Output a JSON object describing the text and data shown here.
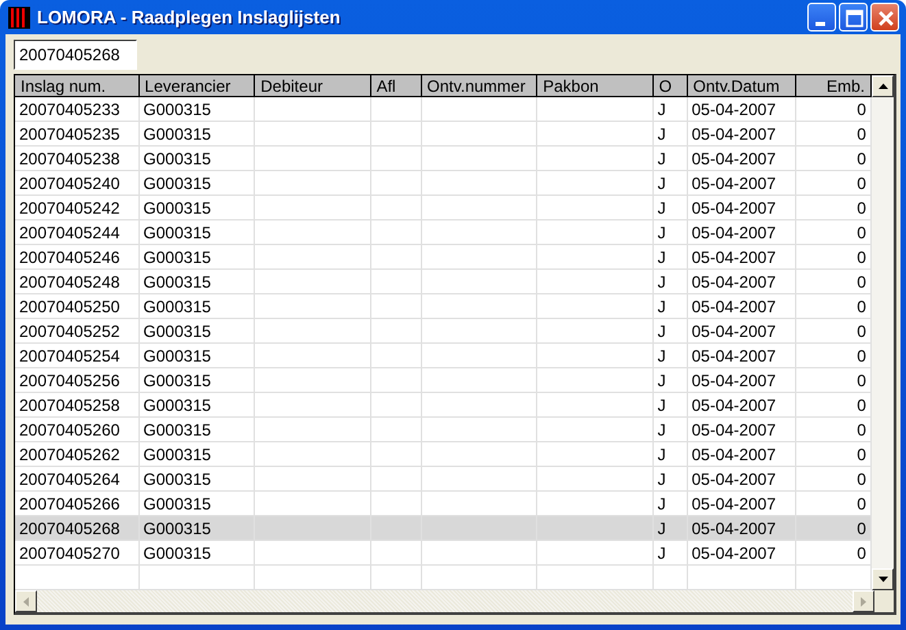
{
  "window": {
    "title": "LOMORA - Raadplegen Inslaglijsten"
  },
  "search": {
    "value": "20070405268"
  },
  "table": {
    "columns": [
      "Inslag num.",
      "Leverancier",
      "Debiteur",
      "Afl",
      "Ontv.nummer",
      "Pakbon",
      "O",
      "Ontv.Datum",
      "Emb."
    ],
    "rows": [
      {
        "cells": [
          "20070405233",
          "G000315",
          "",
          "",
          "",
          "",
          "J",
          "05-04-2007",
          "0"
        ],
        "selected": false
      },
      {
        "cells": [
          "20070405235",
          "G000315",
          "",
          "",
          "",
          "",
          "J",
          "05-04-2007",
          "0"
        ],
        "selected": false
      },
      {
        "cells": [
          "20070405238",
          "G000315",
          "",
          "",
          "",
          "",
          "J",
          "05-04-2007",
          "0"
        ],
        "selected": false
      },
      {
        "cells": [
          "20070405240",
          "G000315",
          "",
          "",
          "",
          "",
          "J",
          "05-04-2007",
          "0"
        ],
        "selected": false
      },
      {
        "cells": [
          "20070405242",
          "G000315",
          "",
          "",
          "",
          "",
          "J",
          "05-04-2007",
          "0"
        ],
        "selected": false
      },
      {
        "cells": [
          "20070405244",
          "G000315",
          "",
          "",
          "",
          "",
          "J",
          "05-04-2007",
          "0"
        ],
        "selected": false
      },
      {
        "cells": [
          "20070405246",
          "G000315",
          "",
          "",
          "",
          "",
          "J",
          "05-04-2007",
          "0"
        ],
        "selected": false
      },
      {
        "cells": [
          "20070405248",
          "G000315",
          "",
          "",
          "",
          "",
          "J",
          "05-04-2007",
          "0"
        ],
        "selected": false
      },
      {
        "cells": [
          "20070405250",
          "G000315",
          "",
          "",
          "",
          "",
          "J",
          "05-04-2007",
          "0"
        ],
        "selected": false
      },
      {
        "cells": [
          "20070405252",
          "G000315",
          "",
          "",
          "",
          "",
          "J",
          "05-04-2007",
          "0"
        ],
        "selected": false
      },
      {
        "cells": [
          "20070405254",
          "G000315",
          "",
          "",
          "",
          "",
          "J",
          "05-04-2007",
          "0"
        ],
        "selected": false
      },
      {
        "cells": [
          "20070405256",
          "G000315",
          "",
          "",
          "",
          "",
          "J",
          "05-04-2007",
          "0"
        ],
        "selected": false
      },
      {
        "cells": [
          "20070405258",
          "G000315",
          "",
          "",
          "",
          "",
          "J",
          "05-04-2007",
          "0"
        ],
        "selected": false
      },
      {
        "cells": [
          "20070405260",
          "G000315",
          "",
          "",
          "",
          "",
          "J",
          "05-04-2007",
          "0"
        ],
        "selected": false
      },
      {
        "cells": [
          "20070405262",
          "G000315",
          "",
          "",
          "",
          "",
          "J",
          "05-04-2007",
          "0"
        ],
        "selected": false
      },
      {
        "cells": [
          "20070405264",
          "G000315",
          "",
          "",
          "",
          "",
          "J",
          "05-04-2007",
          "0"
        ],
        "selected": false
      },
      {
        "cells": [
          "20070405266",
          "G000315",
          "",
          "",
          "",
          "",
          "J",
          "05-04-2007",
          "0"
        ],
        "selected": false
      },
      {
        "cells": [
          "20070405268",
          "G000315",
          "",
          "",
          "",
          "",
          "J",
          "05-04-2007",
          "0"
        ],
        "selected": true
      },
      {
        "cells": [
          "20070405270",
          "G000315",
          "",
          "",
          "",
          "",
          "J",
          "05-04-2007",
          "0"
        ],
        "selected": false
      }
    ]
  }
}
